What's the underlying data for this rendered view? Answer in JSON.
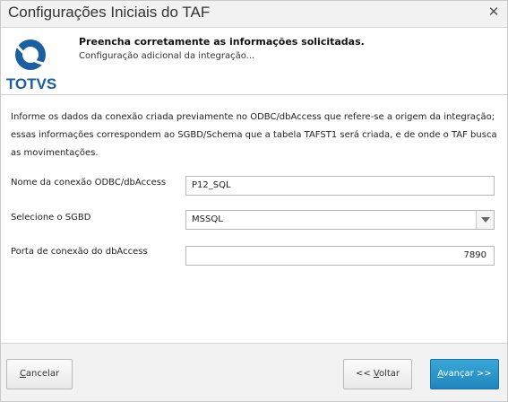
{
  "window": {
    "title": "Configurações Iniciais do TAF",
    "close_glyph": "✕"
  },
  "header": {
    "brand": "TOTVS",
    "title": "Preencha corretamente as informações solicitadas.",
    "subtitle": "Configuração adicional da integração..."
  },
  "info_text": "Informe os dados da conexão criada previamente no ODBC/dbAccess que refere-se a origem da integração; essas informações correspondem ao SGBD/Schema que a tabela TAFST1 será criada, e de onde o TAF busca as movimentações.",
  "form": {
    "connection_label": "Nome da conexão ODBC/dbAccess",
    "connection_value": "P12_SQL",
    "sgbd_label": "Selecione o SGBD",
    "sgbd_value": "MSSQL",
    "port_label": "Porta de conexão do dbAccess",
    "port_value": "7890"
  },
  "buttons": {
    "cancel_first": "C",
    "cancel_rest": "ancelar",
    "back_prefix": "<< ",
    "back_first": "V",
    "back_rest": "oltar",
    "next_first": "A",
    "next_rest": "vançar >>"
  },
  "colors": {
    "brand_blue": "#1a5fa0",
    "primary_button": "#1f86bd"
  },
  "icons": {
    "logo": "totvs-logo-icon",
    "close": "close-icon",
    "dropdown": "chevron-down-icon"
  }
}
